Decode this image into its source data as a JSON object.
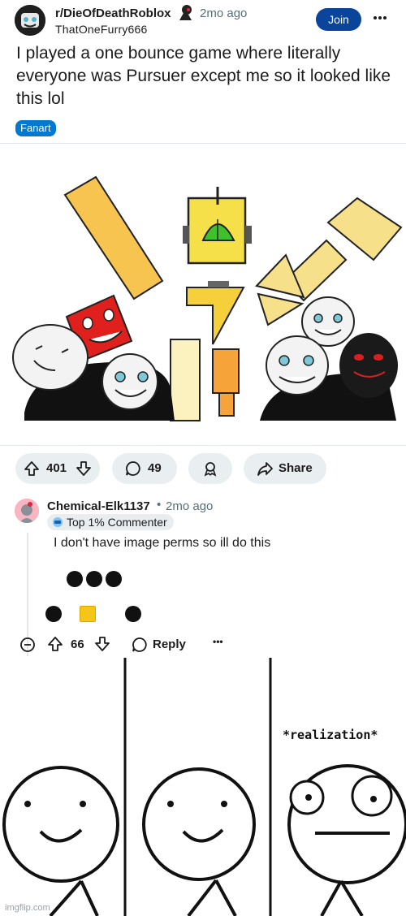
{
  "post": {
    "subreddit": "r/DieOfDeathRoblox",
    "time": "2mo ago",
    "author": "ThatOneFurry666",
    "join_label": "Join",
    "more_label": "•••",
    "title": "I played a one bounce game where literally everyone was Pursuer except me so it looked like this lol",
    "flair": "Fanart"
  },
  "actions": {
    "upvotes": "401",
    "comments": "49",
    "share_label": "Share"
  },
  "comment": {
    "username": "Chemical-Elk1137",
    "separator": "•",
    "time": "2mo ago",
    "badge": "Top 1% Commenter",
    "text": "I don't have image perms so ill do this",
    "votes": "66",
    "reply_label": "Reply",
    "more_label": "•••"
  },
  "meme": {
    "caption": "*realization*"
  },
  "watermark": "imgflip.com",
  "colors": {
    "join_button": "#0a449b",
    "flair": "#0079d3",
    "pill_bg": "#e9eef0",
    "meta_gray": "#576f76"
  }
}
